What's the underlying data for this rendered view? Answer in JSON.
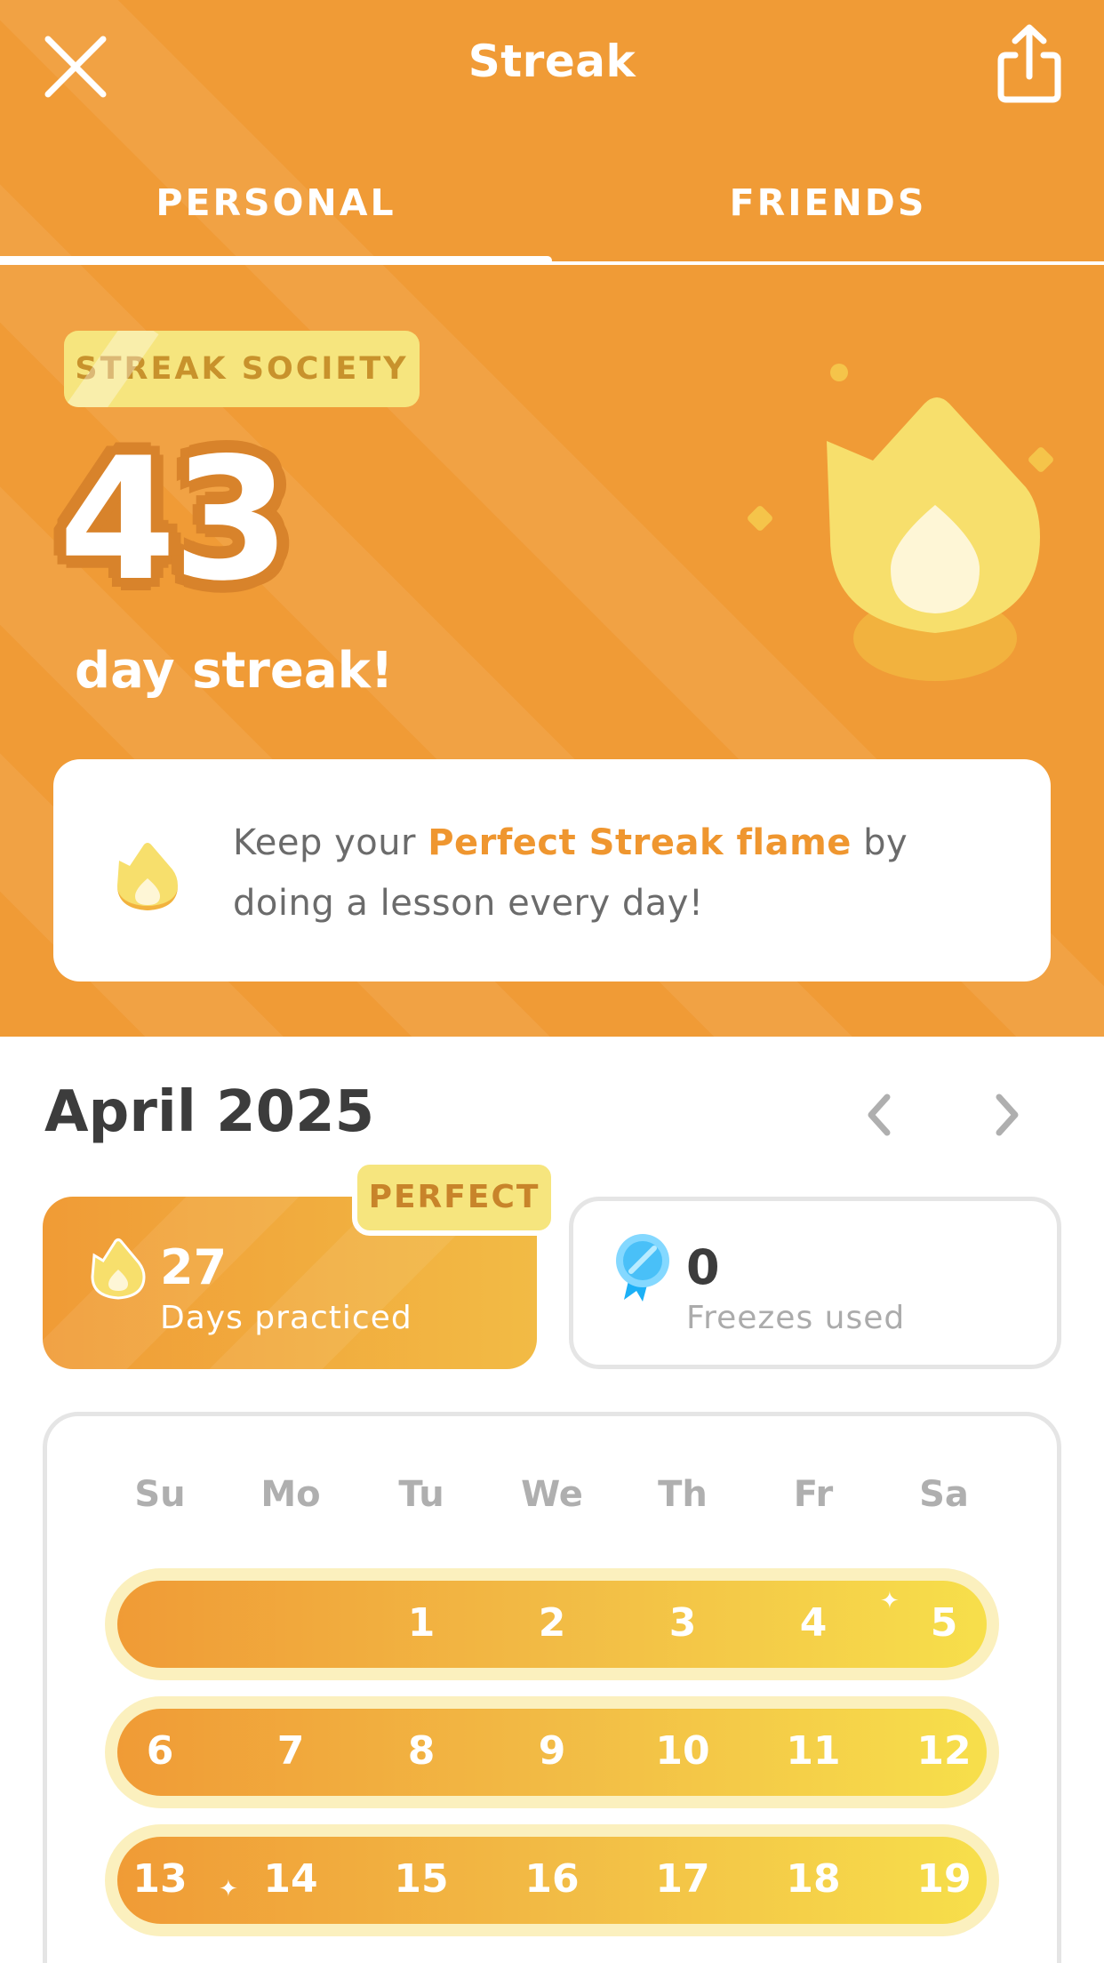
{
  "header": {
    "title": "Streak",
    "tabs": [
      {
        "label": "PERSONAL",
        "active": true
      },
      {
        "label": "FRIENDS",
        "active": false
      }
    ]
  },
  "streak": {
    "badge": "STREAK SOCIETY",
    "count": "43",
    "label": "day streak!"
  },
  "tip": {
    "prefix": "Keep your ",
    "highlight": "Perfect Streak flame",
    "suffix": " by doing a lesson every day!"
  },
  "calendar": {
    "month": "April 2025",
    "practiced": {
      "badge": "PERFECT",
      "value": "27",
      "label": "Days practiced"
    },
    "freezes": {
      "value": "0",
      "label": "Freezes used"
    },
    "weekdays": [
      "Su",
      "Mo",
      "Tu",
      "We",
      "Th",
      "Fr",
      "Sa"
    ],
    "weeks": [
      [
        "",
        "",
        "1",
        "2",
        "3",
        "4",
        "5"
      ],
      [
        "6",
        "7",
        "8",
        "9",
        "10",
        "11",
        "12"
      ],
      [
        "13",
        "14",
        "15",
        "16",
        "17",
        "18",
        "19"
      ]
    ]
  },
  "colors": {
    "hero_orange": "#F09B36",
    "highlight_orange": "#EF962F",
    "badge_yellow": "#F6E57E",
    "flame_yellow": "#F7DF6C"
  },
  "icons": {
    "close": "close-icon",
    "share": "share-icon",
    "flame": "flame-icon",
    "freeze": "freeze-icon",
    "prev": "chevron-left-icon",
    "next": "chevron-right-icon"
  }
}
